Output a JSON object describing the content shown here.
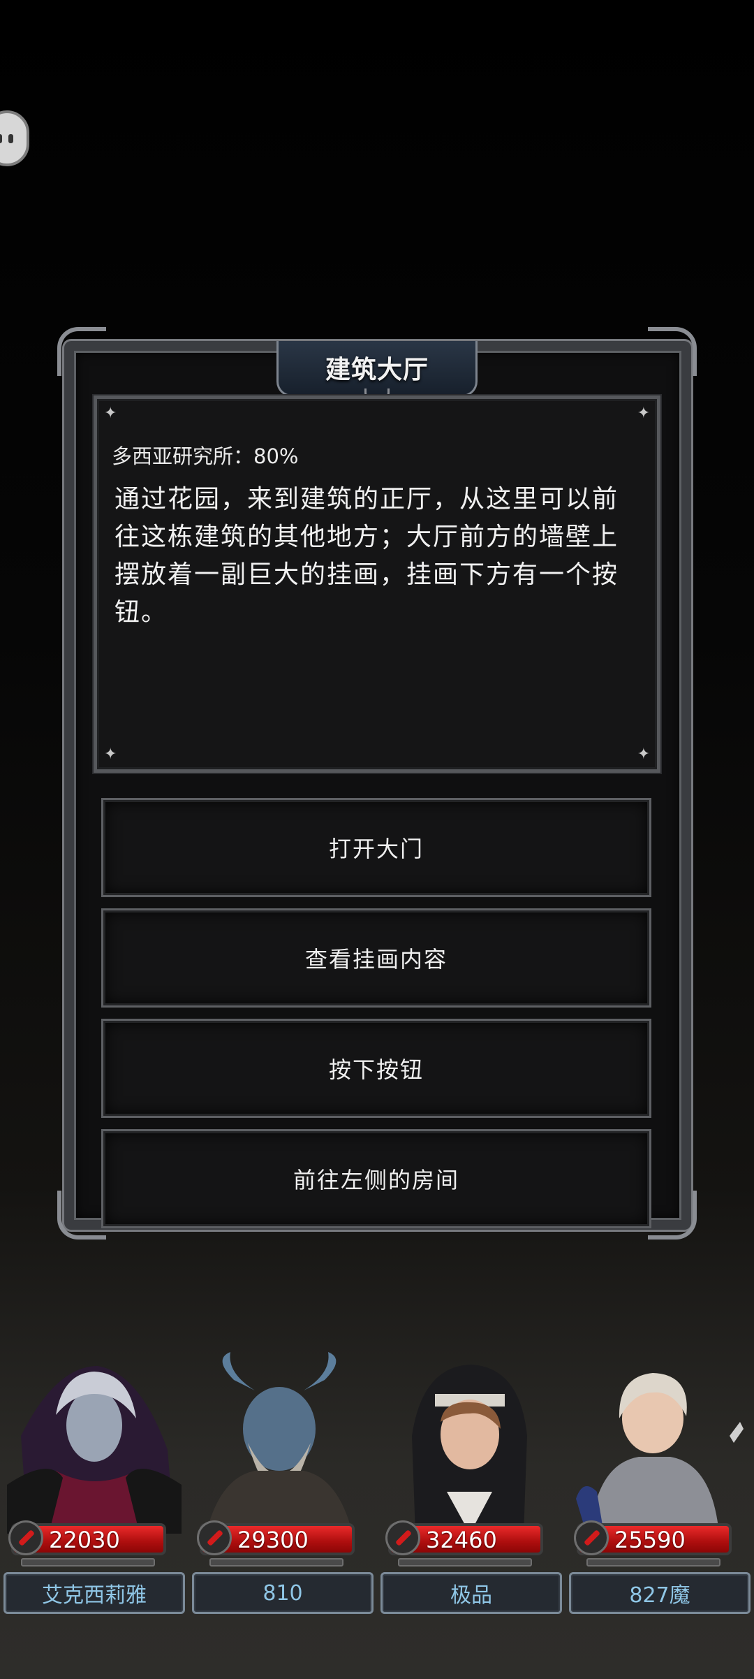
{
  "panel": {
    "title": "建筑大厅",
    "progress": "多西亚研究所：80%",
    "description": "通过花园，来到建筑的正厅，从这里可以前往这栋建筑的其他地方；大厅前方的墙壁上摆放着一副巨大的挂画，挂画下方有一个按钮。"
  },
  "options": [
    {
      "label": "打开大门"
    },
    {
      "label": "查看挂画内容"
    },
    {
      "label": "按下按钮"
    },
    {
      "label": "前往左侧的房间"
    }
  ],
  "party": [
    {
      "hp": "22030",
      "name": "艾克西莉雅",
      "portrait_icon": "sorceress-portrait"
    },
    {
      "hp": "29300",
      "name": "810",
      "portrait_icon": "horned-warrior-portrait"
    },
    {
      "hp": "32460",
      "name": "极品",
      "portrait_icon": "nun-portrait"
    },
    {
      "hp": "25590",
      "name": "827魔",
      "portrait_icon": "knight-portrait"
    }
  ],
  "colors": {
    "hp_bar": "#c01414",
    "name_text": "#8fc6e6",
    "panel_border": "#5d5f63"
  }
}
